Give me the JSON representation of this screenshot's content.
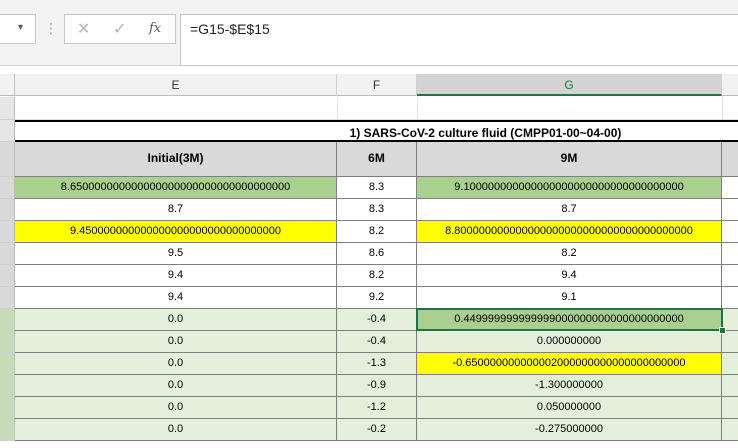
{
  "formula_bar": {
    "name_box_arrow": "▾",
    "separator": "⋮",
    "cancel_glyph": "✕",
    "enter_glyph": "✓",
    "fx_glyph": "fx",
    "formula": "=G15-$E$15"
  },
  "columns": [
    {
      "letter": "E",
      "selected": false
    },
    {
      "letter": "F",
      "selected": false
    },
    {
      "letter": "G",
      "selected": true
    }
  ],
  "table": {
    "title": "1) SARS-CoV-2 culture fluid   (CMPP01-00~04-00)",
    "headers": [
      "Initial(3M)",
      "6M",
      "9M"
    ],
    "rows": [
      {
        "e": "8.650000000000000000000000000000000000",
        "f": "8.3",
        "g": "9.100000000000000000000000000000000000",
        "e_fill": "#a9d08e",
        "g_fill": "#a9d08e",
        "row_fill": "#ffffff",
        "hdr": "#d9d9d9"
      },
      {
        "e": "8.7",
        "f": "8.3",
        "g": "8.7",
        "e_fill": "",
        "g_fill": "",
        "row_fill": "#ffffff",
        "hdr": "#d9d9d9"
      },
      {
        "e": "9.450000000000000000000000000000000",
        "f": "8.2",
        "g": "8.800000000000000000000000000000000000000",
        "e_fill": "#ffff00",
        "g_fill": "#ffff00",
        "row_fill": "#ffffff",
        "hdr": "#d9d9d9"
      },
      {
        "e": "9.5",
        "f": "8.6",
        "g": "8.2",
        "e_fill": "",
        "g_fill": "",
        "row_fill": "#ffffff",
        "hdr": "#d9d9d9"
      },
      {
        "e": "9.4",
        "f": "8.2",
        "g": "9.4",
        "e_fill": "",
        "g_fill": "",
        "row_fill": "#ffffff",
        "hdr": "#d9d9d9"
      },
      {
        "e": "9.4",
        "f": "9.2",
        "g": "9.1",
        "e_fill": "",
        "g_fill": "",
        "row_fill": "#ffffff",
        "hdr": "#d9d9d9"
      },
      {
        "e": "0.0",
        "f": "-0.4",
        "g": "0.449999999999999000000000000000000000",
        "e_fill": "",
        "g_fill": "#a9d08e",
        "row_fill": "#e2efda",
        "hdr": "#c6dcb9"
      },
      {
        "e": "0.0",
        "f": "-0.4",
        "g": "0.000000000",
        "e_fill": "",
        "g_fill": "",
        "row_fill": "#e2efda",
        "hdr": "#c6dcb9"
      },
      {
        "e": "0.0",
        "f": "-1.3",
        "g": "-0.650000000000002000000000000000000000",
        "e_fill": "",
        "g_fill": "#ffff00",
        "row_fill": "#e2efda",
        "hdr": "#c6dcb9"
      },
      {
        "e": "0.0",
        "f": "-0.9",
        "g": "-1.300000000",
        "e_fill": "",
        "g_fill": "",
        "row_fill": "#e2efda",
        "hdr": "#c6dcb9"
      },
      {
        "e": "0.0",
        "f": "-1.2",
        "g": "0.050000000",
        "e_fill": "",
        "g_fill": "",
        "row_fill": "#e2efda",
        "hdr": "#c6dcb9"
      },
      {
        "e": "0.0",
        "f": "-0.2",
        "g": "-0.275000000",
        "e_fill": "",
        "g_fill": "",
        "row_fill": "#e2efda",
        "hdr": "#c6dcb9"
      }
    ],
    "selected_row_index": 6,
    "selected_column": "g"
  },
  "colors": {
    "excel_green": "#217346"
  }
}
